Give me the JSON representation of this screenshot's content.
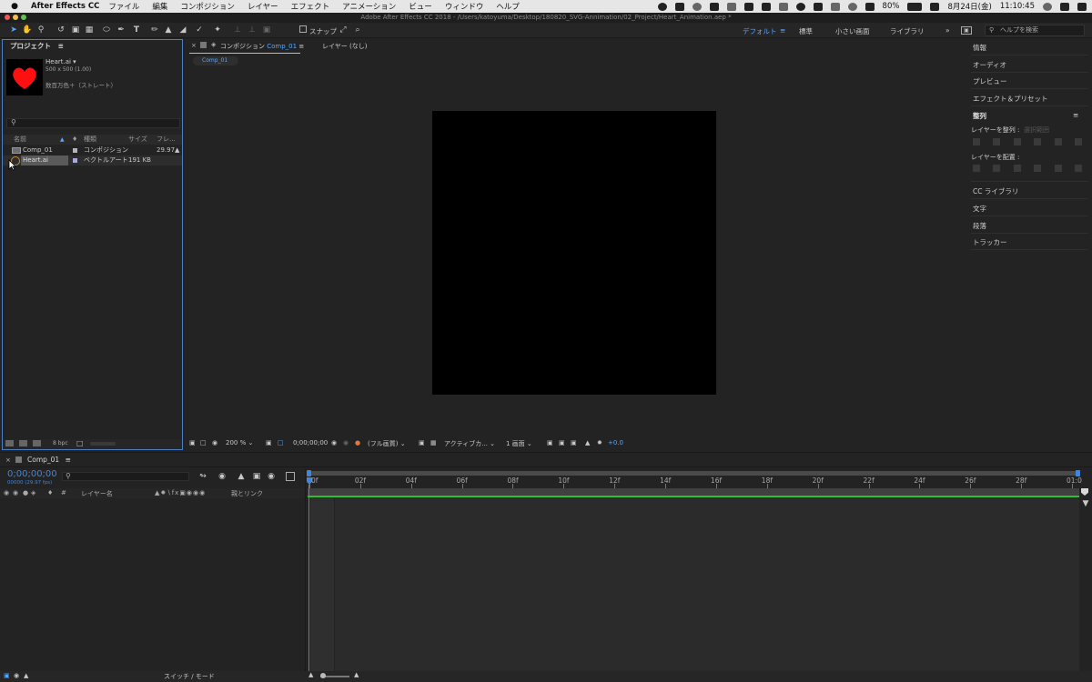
{
  "menubar": {
    "app_name": "After Effects CC",
    "menus": [
      "ファイル",
      "編集",
      "コンポジション",
      "レイヤー",
      "エフェクト",
      "アニメーション",
      "ビュー",
      "ウィンドウ",
      "ヘルプ"
    ],
    "battery": "80%",
    "date": "8月24日(金)",
    "time": "11:10:45"
  },
  "titlebar": {
    "title": "Adobe After Effects CC 2018 - /Users/katoyuma/Desktop/180820_SVG-Annimation/02_Project/Heart_Animation.aep *"
  },
  "toolbar": {
    "snap_label": "スナップ",
    "workspaces": [
      "デフォルト",
      "標準",
      "小さい画面",
      "ライブラリ"
    ],
    "help_placeholder": "ヘルプを検索"
  },
  "project": {
    "title": "プロジェクト",
    "preview_name": "Heart.ai ▾",
    "preview_dims": "500 x 500 (1.00)",
    "preview_colors": "数百万色＋（ストレート）",
    "columns": {
      "name": "名前",
      "type": "種類",
      "size": "サイズ",
      "fps": "フレ..."
    },
    "items": [
      {
        "name": "Comp_01",
        "type": "コンポジション",
        "size": "",
        "fps": "29.97"
      },
      {
        "name": "Heart.ai",
        "type": "ベクトルアート",
        "size": "191 KB",
        "fps": ""
      }
    ],
    "bpc": "8 bpc",
    "colors": {
      "heart": "#ff1010",
      "tag_comp": "#b4b4b4",
      "tag_vector": "#a9a9d6"
    }
  },
  "composition": {
    "tab_prefix": "コンポジション",
    "tab_name": "Comp_01",
    "layer_tab": "レイヤー (なし)",
    "sub_tab": "Comp_01",
    "zoom": "200 %",
    "timecode": "0;00;00;00",
    "resolution": "(フル画質)",
    "camera": "アクティブカ...",
    "views": "1 画面",
    "exposure": "+0.0"
  },
  "right_panels": [
    "情報",
    "オーディオ",
    "プレビュー",
    "エフェクト＆プリセット",
    "整列",
    "CC ライブラリ",
    "文字",
    "段落",
    "トラッカー"
  ],
  "align": {
    "align_to_label": "レイヤーを整列 :",
    "align_to_value": "選択範囲",
    "distribute_label": "レイヤーを配置 :"
  },
  "timeline": {
    "tab": "Comp_01",
    "timecode": "0;00;00;00",
    "frame_info": "00000 (29.97 fps)",
    "col_layer_name": "レイヤー名",
    "col_parent": "親とリンク",
    "switch_mode": "スイッチ / モード",
    "ticks": [
      "0f",
      "02f",
      "04f",
      "06f",
      "08f",
      "10f",
      "12f",
      "14f",
      "16f",
      "18f",
      "20f",
      "22f",
      "24f",
      "26f",
      "28f",
      "01:0"
    ],
    "colors": {
      "work_area": "#27c427",
      "playhead": "#3f86e0",
      "timecode": "#3f86e0"
    }
  }
}
